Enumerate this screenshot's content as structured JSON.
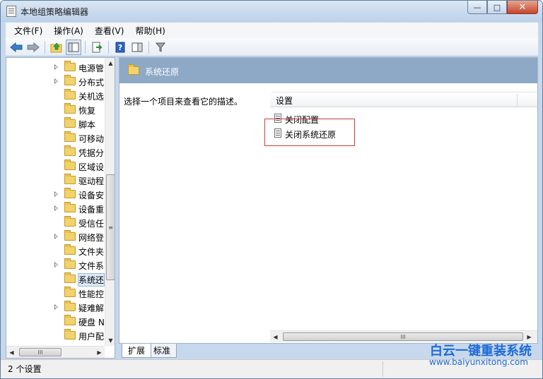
{
  "window": {
    "title": "本地组策略编辑器",
    "controls": {
      "minimize": "—",
      "maximize": "□",
      "close": "✕"
    }
  },
  "menubar": {
    "items": [
      "文件(F)",
      "操作(A)",
      "查看(V)",
      "帮助(H)"
    ]
  },
  "toolbar": {
    "buttons": [
      "back-icon",
      "forward-icon",
      "up-folder-icon",
      "show-hide-tree-icon",
      "export-list-icon",
      "help-icon",
      "show-hide-action-pane-icon",
      "filter-icon"
    ]
  },
  "tree": {
    "items": [
      {
        "label": "电源管",
        "expandable": true,
        "selected": false
      },
      {
        "label": "分布式",
        "expandable": true,
        "selected": false
      },
      {
        "label": "关机选",
        "expandable": false,
        "selected": false
      },
      {
        "label": "恢复",
        "expandable": false,
        "selected": false
      },
      {
        "label": "脚本",
        "expandable": false,
        "selected": false
      },
      {
        "label": "可移动",
        "expandable": false,
        "selected": false
      },
      {
        "label": "凭据分",
        "expandable": false,
        "selected": false
      },
      {
        "label": "区域设",
        "expandable": false,
        "selected": false
      },
      {
        "label": "驱动程",
        "expandable": false,
        "selected": false
      },
      {
        "label": "设备安",
        "expandable": true,
        "selected": false
      },
      {
        "label": "设备重",
        "expandable": true,
        "selected": false
      },
      {
        "label": "受信任",
        "expandable": false,
        "selected": false
      },
      {
        "label": "网络登",
        "expandable": true,
        "selected": false
      },
      {
        "label": "文件夹",
        "expandable": false,
        "selected": false
      },
      {
        "label": "文件系",
        "expandable": true,
        "selected": false
      },
      {
        "label": "系统还",
        "expandable": false,
        "selected": true
      },
      {
        "label": "性能控",
        "expandable": false,
        "selected": false
      },
      {
        "label": "疑难解",
        "expandable": true,
        "selected": false
      },
      {
        "label": "硬盘 N",
        "expandable": false,
        "selected": false
      },
      {
        "label": "用户配",
        "expandable": false,
        "selected": false
      }
    ],
    "scroll_thumb_glyph": "≡",
    "hscroll_thumb_glyph": "III"
  },
  "details": {
    "header_title": "系统还原",
    "description": "选择一个项目来查看它的描述。",
    "column_setting": "设置",
    "items": [
      "关闭配置",
      "关闭系统还原"
    ],
    "hscroll_thumb_glyph": "III"
  },
  "tabs": [
    {
      "label": "扩展",
      "active": true
    },
    {
      "label": "标准",
      "active": false
    }
  ],
  "status": {
    "text": "2 个设置"
  },
  "watermark": {
    "line1": "白云一键重装系统",
    "line2": "www.baiyunxitong.com"
  },
  "colors": {
    "header_bar": "#8ea9c6",
    "highlight_box": "#cc3b3b",
    "watermark": "#1e6bd6",
    "selection": "#dce9f7"
  }
}
